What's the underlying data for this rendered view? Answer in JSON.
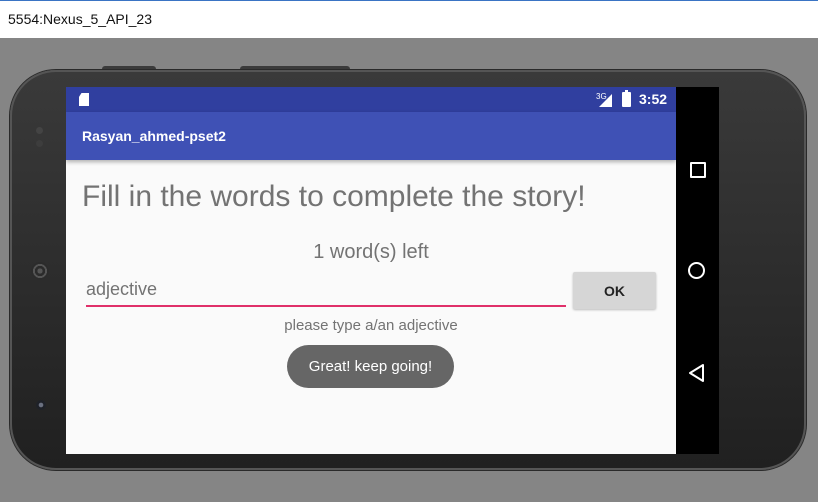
{
  "window": {
    "title": "5554:Nexus_5_API_23"
  },
  "statusbar": {
    "network": "3G",
    "time": "3:52",
    "icons": [
      "sd-card-icon",
      "signal-icon",
      "battery-icon"
    ]
  },
  "toolbar": {
    "title": "Rasyan_ahmed-pset2"
  },
  "main": {
    "heading": "Fill in the words to complete the story!",
    "words_left": "1 word(s) left",
    "input": {
      "value": "",
      "placeholder": "adjective"
    },
    "ok_label": "OK",
    "hint": "please type a/an adjective",
    "toast": "Great! keep going!"
  },
  "navbar": {
    "icons": [
      "recent-apps-icon",
      "home-icon",
      "back-icon"
    ]
  },
  "colors": {
    "statusbar": "#303f9f",
    "toolbar": "#3f51b5",
    "input_underline": "#e0306a",
    "toast": "#666666"
  }
}
